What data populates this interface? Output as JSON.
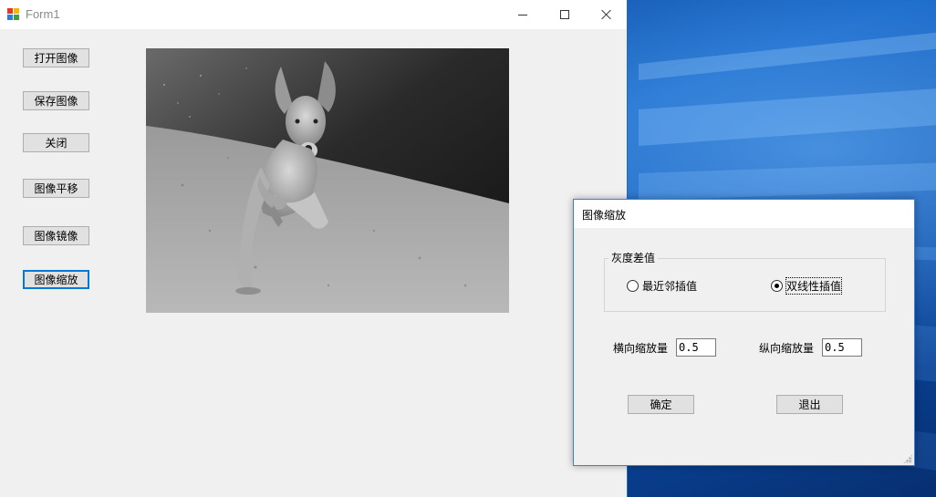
{
  "main_window": {
    "title": "Form1",
    "buttons": [
      {
        "label": "打开图像"
      },
      {
        "label": "保存图像"
      },
      {
        "label": "关闭"
      },
      {
        "label": "图像平移"
      },
      {
        "label": "图像镜像"
      },
      {
        "label": "图像缩放"
      }
    ],
    "image": {
      "subject": "grayscale photo of a running dog"
    }
  },
  "dialog": {
    "title": "图像缩放",
    "group_title": "灰度差值",
    "radio_options": [
      {
        "label": "最近邻插值",
        "checked": false
      },
      {
        "label": "双线性插值",
        "checked": true
      }
    ],
    "horizontal_label": "横向缩放量",
    "horizontal_value": "0.5",
    "vertical_label": "纵向缩放量",
    "vertical_value": "0.5",
    "ok_label": "确定",
    "exit_label": "退出"
  },
  "colors": {
    "accent": "#0078d7",
    "window_bg": "#f0f0f0",
    "desktop": "#0d5fc4"
  }
}
